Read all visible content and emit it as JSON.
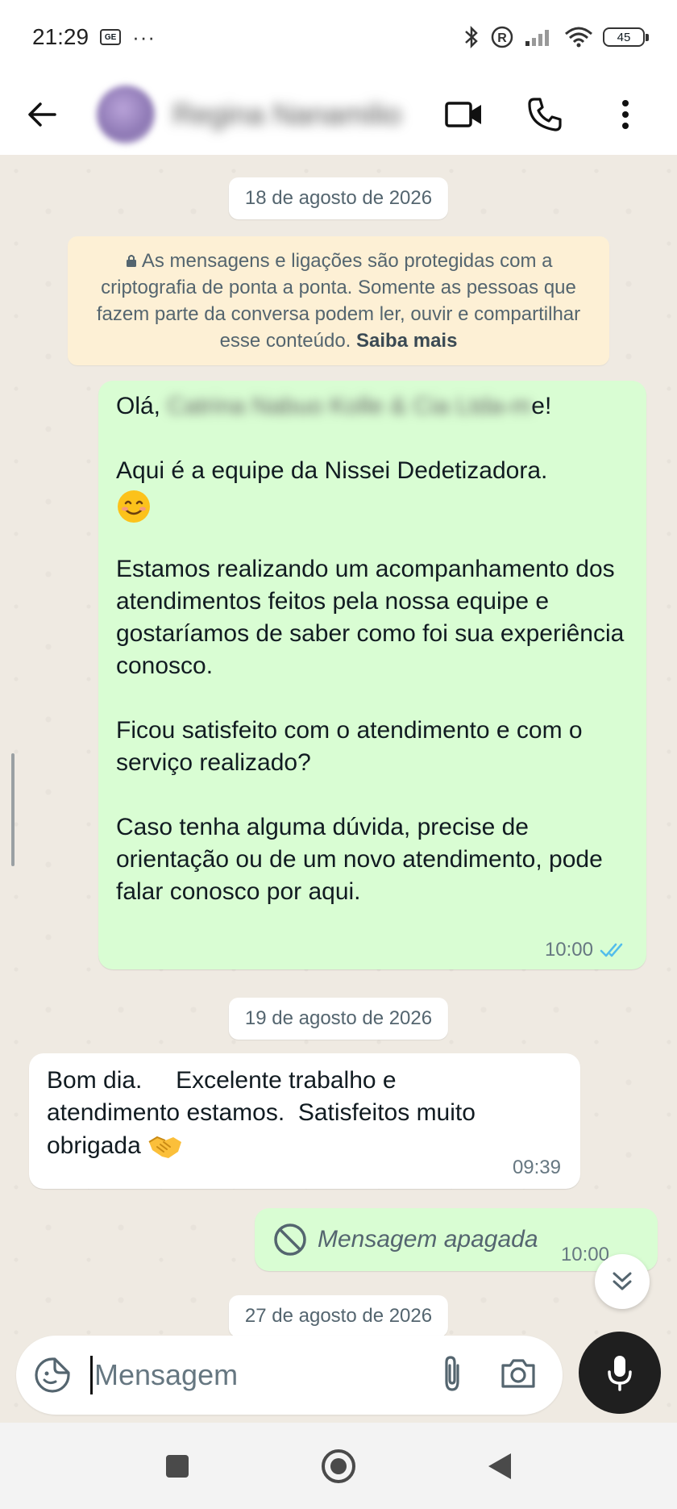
{
  "status_bar": {
    "time": "21:29",
    "battery": "45",
    "icons": [
      "sim-icon",
      "more-dots-icon",
      "bluetooth-icon",
      "registered-icon",
      "signal-icon",
      "wifi-icon",
      "battery-icon"
    ]
  },
  "header": {
    "contact_name": "Regina Nanamilio",
    "icons": [
      "back-arrow-icon",
      "video-call-icon",
      "phone-call-icon",
      "more-options-icon"
    ]
  },
  "chat": {
    "date_1": "18 de agosto de 2026",
    "encryption_notice": "As mensagens e ligações são protegidas com a criptografia de ponta a ponta. Somente as pessoas que fazem parte da conversa podem ler, ouvir e compartilhar esse conteúdo.",
    "encryption_link": "Saiba mais",
    "msg1": {
      "greeting": "Olá,",
      "redacted": "Catrina Nabuo Kolle & Cia Ltda-m",
      "greeting_end": "e!",
      "line2": "Aqui é a equipe da Nissei Dedetizadora.",
      "para2": "Estamos realizando um acompanhamento dos atendimentos feitos pela nossa equipe e gostaríamos de saber como foi sua experiência conosco.",
      "para3": "Ficou satisfeito com o atendimento e com o serviço realizado?",
      "para4": "Caso tenha alguma dúvida, precise de orientação ou de um novo atendimento, pode falar conosco por aqui.",
      "time": "10:00",
      "status": "read"
    },
    "date_2": "19 de agosto de 2026",
    "msg2": {
      "text": "Bom dia.     Excelente trabalho e atendimento estamos.  Satisfeitos muito obrigada",
      "time": "09:39"
    },
    "msg3": {
      "text": "Mensagem apagada",
      "time": "10:00"
    },
    "date_3": "27 de agosto de 2026"
  },
  "input": {
    "placeholder": "Mensagem"
  },
  "colors": {
    "outgoing_bubble": "#d9fdd3",
    "incoming_bubble": "#ffffff",
    "chat_background": "#efeae2",
    "read_ticks": "#53bdeb",
    "notice_background": "#fdf0d5"
  }
}
